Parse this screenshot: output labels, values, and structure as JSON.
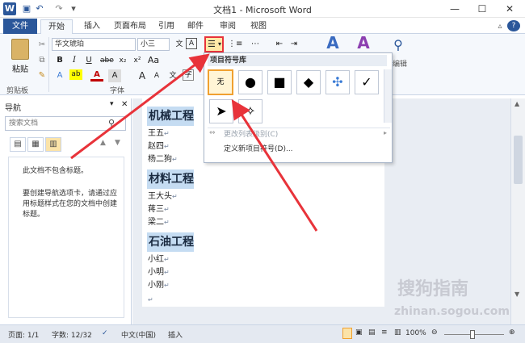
{
  "window": {
    "title": "文档1 - Microsoft Word",
    "app_icon": "W",
    "minimize": "—",
    "maximize": "☐",
    "close": "✕"
  },
  "tabs": [
    {
      "label": "文件"
    },
    {
      "label": "开始"
    },
    {
      "label": "插入"
    },
    {
      "label": "页面布局"
    },
    {
      "label": "引用"
    },
    {
      "label": "邮件"
    },
    {
      "label": "审阅"
    },
    {
      "label": "视图"
    }
  ],
  "ribbon": {
    "paste_label": "粘贴",
    "clipboard_group": "剪贴板",
    "font_group": "字体",
    "font_name": "华文琥珀",
    "font_size": "小三",
    "bold": "B",
    "italic": "I",
    "underline": "U",
    "strike": "abe",
    "subscript": "x₂",
    "superscript": "x²",
    "grow": "A",
    "shrink": "A",
    "aa": "Aa",
    "styles_label": "编辑"
  },
  "gallery": {
    "title": "项目符号库",
    "none_label": "无",
    "bullets": [
      "●",
      "■",
      "◆",
      "✣",
      "✓",
      "➤",
      "✧"
    ],
    "menu_change_level": "更改列表级别(C)",
    "menu_define": "定义新项目符号(D)..."
  },
  "nav": {
    "header": "导航",
    "search_placeholder": "搜索文档",
    "no_heading": "此文档不包含标题。",
    "hint": "要创建导航选项卡，请通过应用标题样式在您的文档中创建标题。"
  },
  "document": {
    "sections": [
      {
        "heading": "机械工程",
        "items": [
          "王五",
          "赵四",
          "杨二狗"
        ]
      },
      {
        "heading": "材料工程",
        "items": [
          "王大头",
          "蒋三",
          "梁二"
        ]
      },
      {
        "heading": "石油工程",
        "items": [
          "小红",
          "小明",
          "小刚"
        ]
      }
    ],
    "para_mark": "↵"
  },
  "status": {
    "page": "页面: 1/1",
    "words": "字数: 12/32",
    "language": "中文(中国)",
    "insert": "插入",
    "zoom": "100%"
  },
  "watermark": {
    "text": "搜狗指南",
    "url": "zhinan.sogou.com"
  },
  "colors": {
    "accent": "#2b579a",
    "arrow": "#e8333a",
    "highlight": "#c5dcf2"
  }
}
